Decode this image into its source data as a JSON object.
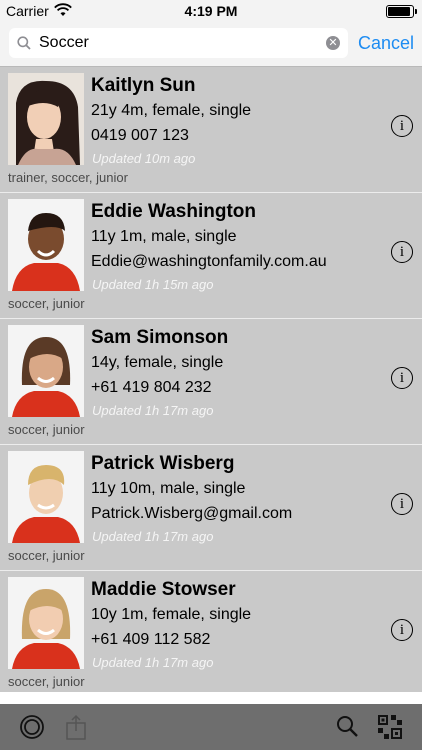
{
  "status_bar": {
    "carrier": "Carrier",
    "time": "4:19 PM"
  },
  "search": {
    "value": "Soccer",
    "cancel_label": "Cancel"
  },
  "contacts": [
    {
      "name": "Kaitlyn Sun",
      "details": "21y 4m, female, single",
      "contact": "0419 007 123",
      "updated": "Updated 10m ago",
      "tags": "trainer, soccer, junior"
    },
    {
      "name": "Eddie Washington",
      "details": "11y 1m, male, single",
      "contact": "Eddie@washingtonfamily.com.au",
      "updated": "Updated 1h 15m ago",
      "tags": "soccer, junior"
    },
    {
      "name": "Sam Simonson",
      "details": "14y, female, single",
      "contact": "+61 419 804 232",
      "updated": "Updated 1h 17m ago",
      "tags": "soccer, junior"
    },
    {
      "name": "Patrick Wisberg",
      "details": "11y 10m, male, single",
      "contact": "Patrick.Wisberg@gmail.com",
      "updated": "Updated 1h 17m ago",
      "tags": "soccer, junior"
    },
    {
      "name": "Maddie Stowser",
      "details": "10y 1m, female, single",
      "contact": "+61 409 112 582",
      "updated": "Updated 1h 17m ago",
      "tags": "soccer, junior"
    }
  ],
  "info_glyph": "i",
  "toolbar": {
    "icons": [
      "rings-icon",
      "share-icon",
      "search-icon",
      "qr-grid-icon"
    ]
  },
  "colors": {
    "accent": "#1d8cf2",
    "list_background": "#c9c9c9",
    "toolbar": "#6e6e6e"
  }
}
